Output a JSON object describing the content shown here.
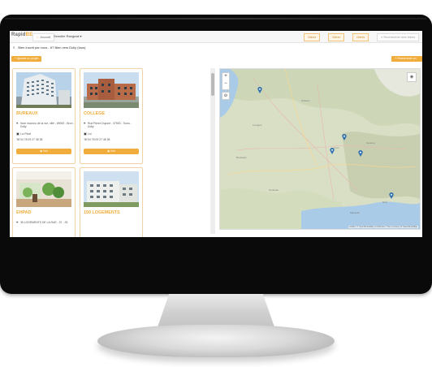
{
  "topbar": {
    "logo_main": "Rapid",
    "logo_accent": "BE",
    "home_label": "Accueil",
    "project_label": "Sensibe Rangeaii",
    "btn1": "Gérer",
    "btn2": "Gérer",
    "btn3": "Gérer",
    "search_placeholder": "Rechercher des biens"
  },
  "subhead": {
    "title": "Bien inscrit par vous - 67 Bien vers Dolly (tous)",
    "left_btn": "Ajouter un projet",
    "right_btn": "Rechercher un bien"
  },
  "cards": [
    {
      "title": "BUREAUX",
      "address": "Nom inconnu de la rue, ville - 69000 - Bron -",
      "address2": "Dolly",
      "type": "Loi Pinel",
      "phone": "04 78 09 27 38 38",
      "btn": "Voir"
    },
    {
      "title": "COLLEGE",
      "address": "Rue Pierre Dupont - 37500 - Tours -",
      "address2": "Dolly",
      "type": "Loi",
      "phone": "04 78 09 27 48 38",
      "btn": "Voir"
    },
    {
      "title": "EHPAD",
      "address": "35 LOGEMENTS DE LA RUE - 37 - 25",
      "address2": "",
      "type": "",
      "phone": "",
      "btn": ""
    },
    {
      "title": "150 LOGEMENTS",
      "address": "",
      "address2": "",
      "type": "",
      "phone": "",
      "btn": ""
    }
  ],
  "map": {
    "zoom_in": "+",
    "zoom_out": "−",
    "attribution": "Leaflet | © OpenStreetMap contributors, Tiles courtesy of OpenStreetMap"
  },
  "colors": {
    "accent": "#f0ad3c",
    "pin": "#2e6fb0"
  }
}
